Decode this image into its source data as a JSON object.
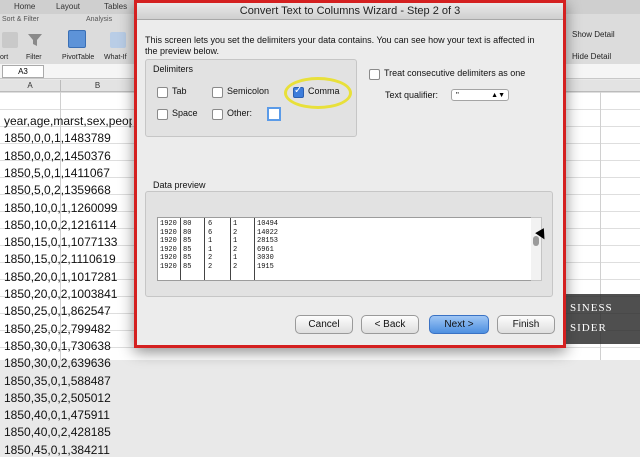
{
  "excel": {
    "tabs": [
      "Home",
      "Layout",
      "Tables"
    ],
    "ribbon_groups": [
      "Sort & Filter",
      "Analysis"
    ],
    "ribbon_buttons": [
      "Filter",
      "PivotTable",
      "What-If"
    ],
    "left_partial": "ort",
    "cell_ref": "A3",
    "col_heads": [
      "A",
      "B"
    ],
    "right_panel": [
      "Show Detail",
      "Hide Detail"
    ],
    "rows": [
      "year,age,marst,sex,people",
      "1850,0,0,1,1483789",
      "1850,0,0,2,1450376",
      "1850,5,0,1,1411067",
      "1850,5,0,2,1359668",
      "1850,10,0,1,1260099",
      "1850,10,0,2,1216114",
      "1850,15,0,1,1077133",
      "1850,15,0,2,1110619",
      "1850,20,0,1,1017281",
      "1850,20,0,2,1003841",
      "1850,25,0,1,862547",
      "1850,25,0,2,799482",
      "1850,30,0,1,730638",
      "1850,30,0,2,639636",
      "1850,35,0,1,588487",
      "1850,35,0,2,505012",
      "1850,40,0,1,475911",
      "1850,40,0,2,428185",
      "1850,45,0,1,384211"
    ]
  },
  "dialog": {
    "title": "Convert Text to Columns Wizard - Step 2 of 3",
    "intro": "This screen lets you set the delimiters your data contains.  You can see how your text is affected in the preview below.",
    "delimiters_label": "Delimiters",
    "options": {
      "tab": {
        "label": "Tab",
        "checked": false
      },
      "semicolon": {
        "label": "Semicolon",
        "checked": false
      },
      "comma": {
        "label": "Comma",
        "checked": true
      },
      "space": {
        "label": "Space",
        "checked": false
      },
      "other": {
        "label": "Other:",
        "checked": false,
        "value": ""
      }
    },
    "consecutive": {
      "label": "Treat consecutive delimiters as one",
      "checked": false
    },
    "qualifier_label": "Text qualifier:",
    "qualifier_value": "\"",
    "preview_label": "Data preview",
    "preview_rows": [
      [
        "1920",
        "80",
        "6",
        "1",
        "10494"
      ],
      [
        "1920",
        "80",
        "6",
        "2",
        "14022"
      ],
      [
        "1920",
        "85",
        "1",
        "1",
        "28153"
      ],
      [
        "1920",
        "85",
        "1",
        "2",
        "6961"
      ],
      [
        "1920",
        "85",
        "2",
        "1",
        "3030"
      ],
      [
        "1920",
        "85",
        "2",
        "2",
        "1915"
      ]
    ],
    "buttons": {
      "cancel": "Cancel",
      "back": "< Back",
      "next": "Next >",
      "finish": "Finish"
    }
  },
  "watermark": [
    "BUSINESS",
    "INSIDER"
  ],
  "watermark_visible": [
    "SINESS",
    "SIDER"
  ],
  "colors": {
    "highlight": "#e8e03a",
    "dialog_border": "#d42020",
    "primary_button": "#4d8fe0"
  }
}
